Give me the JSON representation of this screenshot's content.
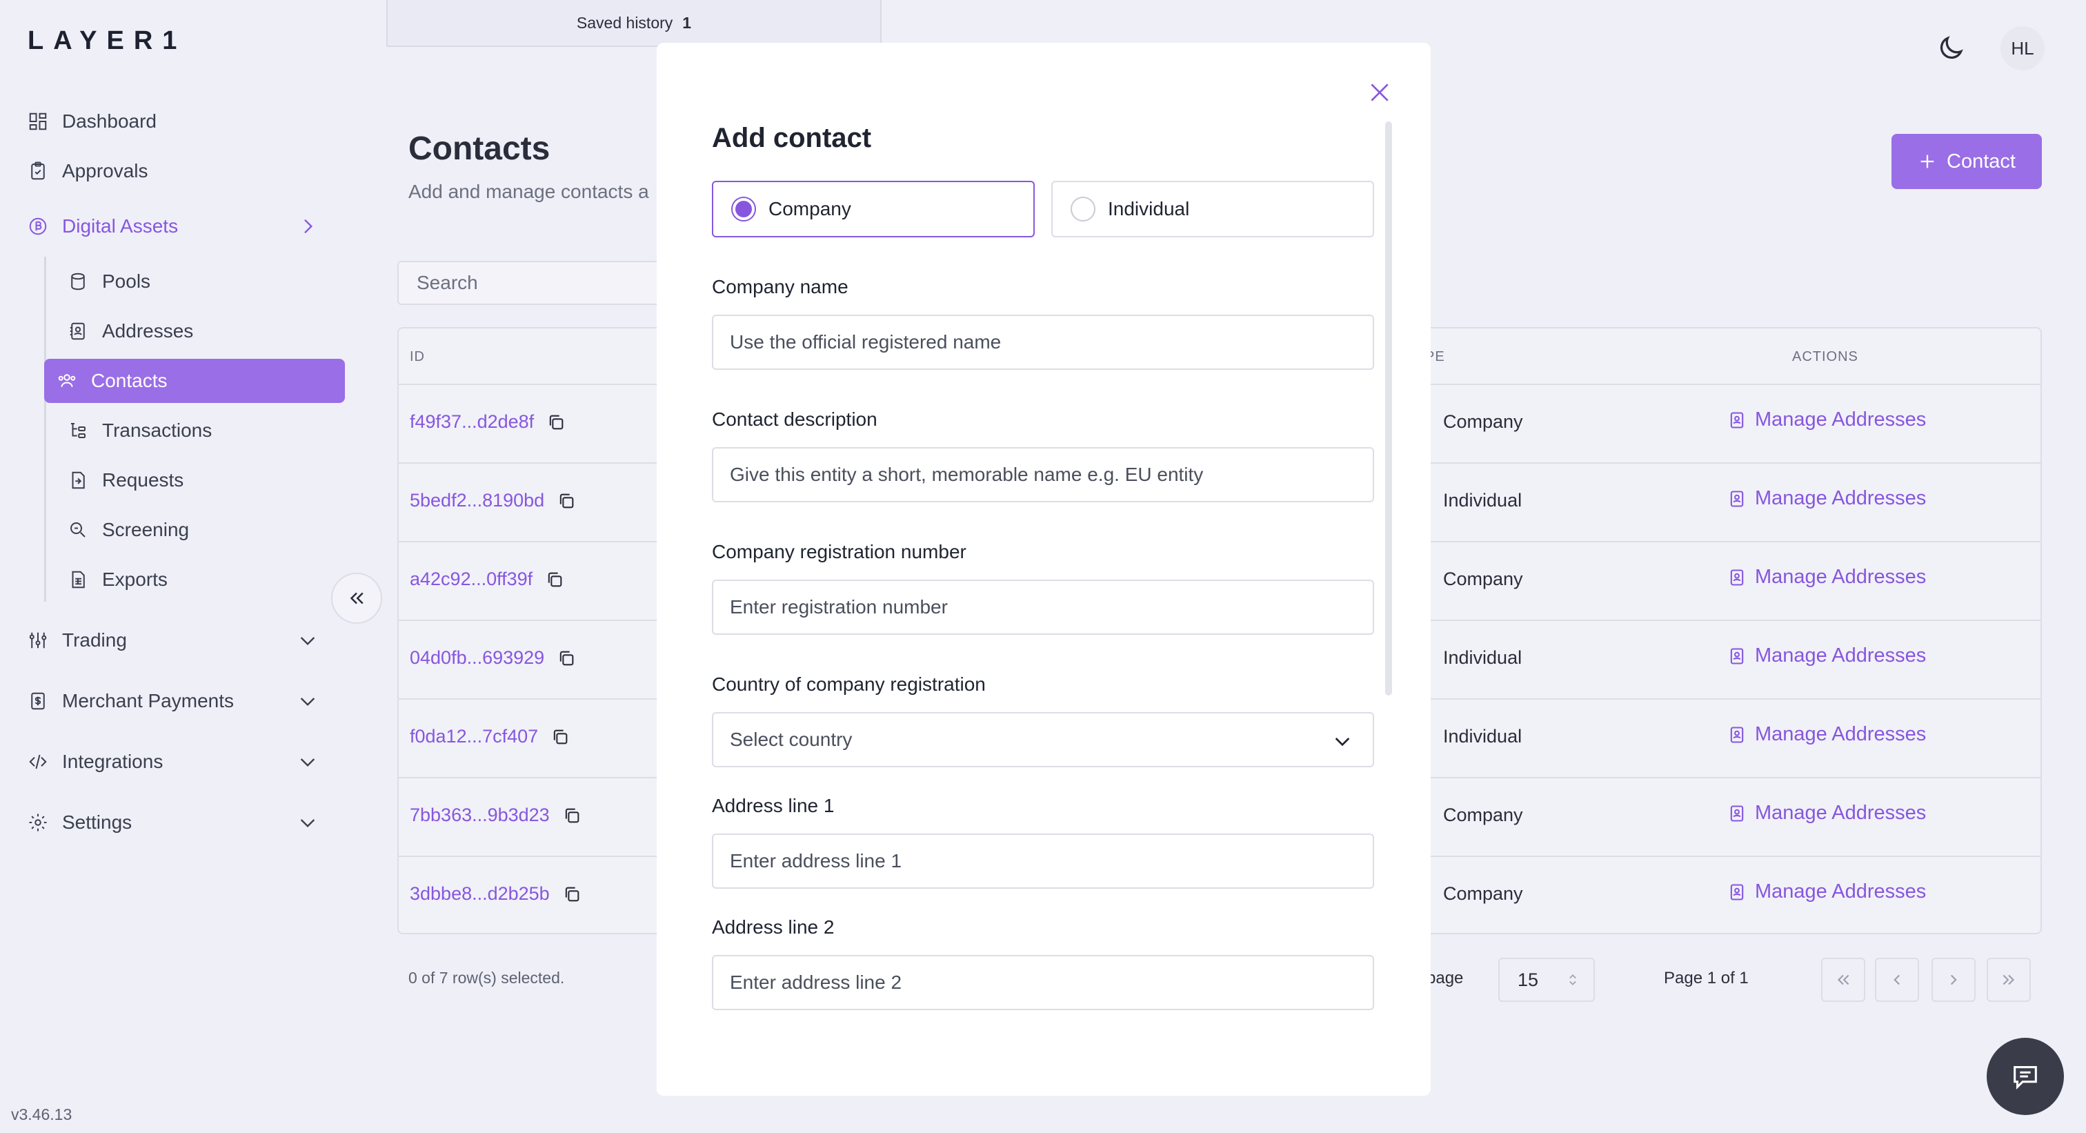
{
  "app": {
    "logo": "LAYER1",
    "version": "v3.46.13",
    "saved_history": {
      "label": "Saved history",
      "count": "1"
    },
    "user_initials": "HL"
  },
  "sidebar": {
    "items": [
      {
        "label": "Dashboard",
        "icon": "dashboard-icon"
      },
      {
        "label": "Approvals",
        "icon": "clipboard-icon"
      },
      {
        "label": "Digital Assets",
        "icon": "bitcoin-icon",
        "active": true
      },
      {
        "label": "Trading",
        "icon": "sliders-icon"
      },
      {
        "label": "Merchant Payments",
        "icon": "dollar-doc-icon"
      },
      {
        "label": "Integrations",
        "icon": "code-icon"
      },
      {
        "label": "Settings",
        "icon": "gear-icon"
      }
    ],
    "sub_items": [
      {
        "label": "Pools"
      },
      {
        "label": "Addresses"
      },
      {
        "label": "Contacts",
        "active": true
      },
      {
        "label": "Transactions"
      },
      {
        "label": "Requests"
      },
      {
        "label": "Screening"
      },
      {
        "label": "Exports"
      }
    ]
  },
  "page": {
    "title": "Contacts",
    "subtitle": "Add and manage contacts a",
    "add_button": "Contact",
    "search_placeholder": "Search"
  },
  "table": {
    "headers": {
      "id": "ID",
      "type": "PE",
      "actions": "ACTIONS"
    },
    "rows": [
      {
        "id": "f49f37...d2de8f",
        "type": "Company",
        "action": "Manage Addresses"
      },
      {
        "id": "5bedf2...8190bd",
        "type": "Individual",
        "action": "Manage Addresses"
      },
      {
        "id": "a42c92...0ff39f",
        "type": "Company",
        "action": "Manage Addresses"
      },
      {
        "id": "04d0fb...693929",
        "type": "Individual",
        "action": "Manage Addresses"
      },
      {
        "id": "f0da12...7cf407",
        "type": "Individual",
        "action": "Manage Addresses"
      },
      {
        "id": "7bb363...9b3d23",
        "type": "Company",
        "action": "Manage Addresses"
      },
      {
        "id": "3dbbe8...d2b25b",
        "type": "Company",
        "action": "Manage Addresses"
      }
    ],
    "selected_text": "0 of 7 row(s) selected.",
    "per_page_label": "er page",
    "per_page_value": "15",
    "page_info": "Page 1 of 1"
  },
  "modal": {
    "title": "Add contact",
    "types": [
      "Company",
      "Individual"
    ],
    "selected_type": "Company",
    "fields": [
      {
        "label": "Company name",
        "placeholder": "Use the official registered name"
      },
      {
        "label": "Contact description",
        "placeholder": "Give this entity a short, memorable name e.g. EU entity"
      },
      {
        "label": "Company registration number",
        "placeholder": "Enter registration number"
      },
      {
        "label": "Country of company registration",
        "placeholder": "Select country"
      },
      {
        "label": "Address line 1",
        "placeholder": "Enter address line 1"
      },
      {
        "label": "Address line 2",
        "placeholder": "Enter address line 2"
      }
    ]
  },
  "colors": {
    "accent": "#9a6ee6",
    "accent_text": "#8657de",
    "background": "#efeff8"
  }
}
